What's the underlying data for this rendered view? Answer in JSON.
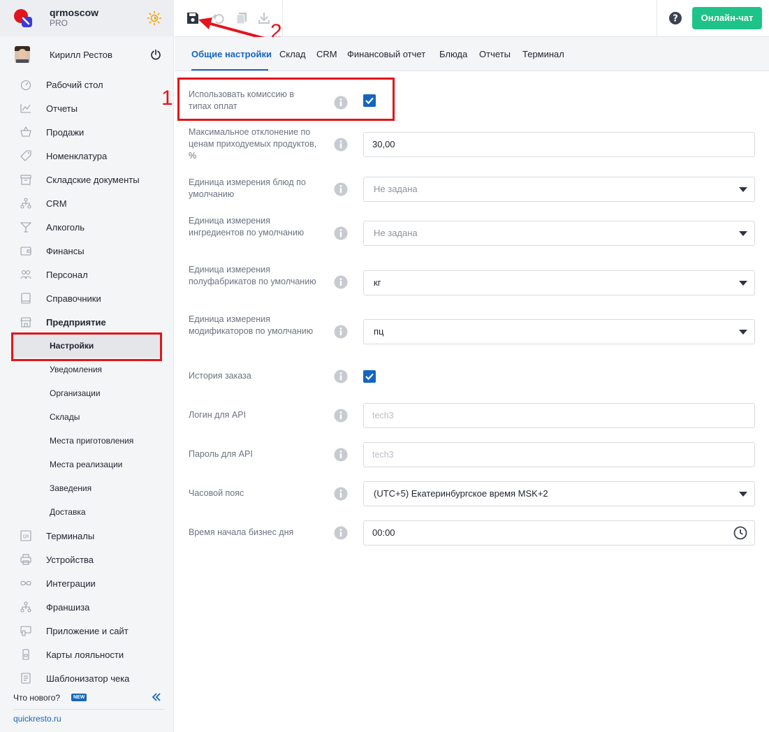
{
  "colors": {
    "accent": "#1565c0",
    "chat": "#1ec38a",
    "annotation": "#e3141b"
  },
  "brand": {
    "name": "qrmoscow",
    "plan": "PRO"
  },
  "user": {
    "name": "Кирилл Рестов"
  },
  "sidebar": {
    "items": [
      {
        "label": "Рабочий стол",
        "icon": "dashboard-icon"
      },
      {
        "label": "Отчеты",
        "icon": "chart-icon"
      },
      {
        "label": "Продажи",
        "icon": "basket-icon"
      },
      {
        "label": "Номенклатура",
        "icon": "tag-icon"
      },
      {
        "label": "Складские документы",
        "icon": "archive-icon"
      },
      {
        "label": "CRM",
        "icon": "hierarchy-icon"
      },
      {
        "label": "Алкоголь",
        "icon": "cocktail-icon"
      },
      {
        "label": "Финансы",
        "icon": "wallet-icon"
      },
      {
        "label": "Персонал",
        "icon": "people-icon"
      },
      {
        "label": "Справочники",
        "icon": "book-icon"
      },
      {
        "label": "Предприятие",
        "icon": "store-icon"
      }
    ],
    "sub_items": [
      {
        "label": "Настройки"
      },
      {
        "label": "Уведомления"
      },
      {
        "label": "Организации"
      },
      {
        "label": "Склады"
      },
      {
        "label": "Места приготовления"
      },
      {
        "label": "Места реализации"
      },
      {
        "label": "Заведения"
      },
      {
        "label": "Доставка"
      }
    ],
    "items_after": [
      {
        "label": "Терминалы",
        "icon": "qr-icon"
      },
      {
        "label": "Устройства",
        "icon": "printer-icon"
      },
      {
        "label": "Интеграции",
        "icon": "infinity-icon"
      },
      {
        "label": "Франшиза",
        "icon": "hierarchy-icon"
      },
      {
        "label": "Приложение и сайт",
        "icon": "devices-icon"
      },
      {
        "label": "Карты лояльности",
        "icon": "card-icon"
      },
      {
        "label": "Шаблонизатор чека",
        "icon": "receipt-icon"
      }
    ],
    "whats_new": "Что нового?",
    "new_badge": "NEW",
    "site_link": "quickresto.ru"
  },
  "toolbar": {
    "chat_label": "Онлайн-чат"
  },
  "annotations": {
    "one": "1",
    "two": "2"
  },
  "tabs": [
    "Общие настройки",
    "Склад",
    "CRM",
    "Финансовый отчет",
    "Блюда",
    "Отчеты",
    "Терминал"
  ],
  "form": {
    "commission": {
      "label": "Использовать комиссию в типах оплат",
      "checked": true
    },
    "max_deviation": {
      "label": "Максимальное отклонение по ценам приходуемых продуктов, %",
      "value": "30,00"
    },
    "dish_unit": {
      "label": "Единица измерения блюд по умолчанию",
      "value": "Не задана"
    },
    "ingredient_unit": {
      "label": "Единица измерения ингредиентов по умолчанию",
      "value": "Не задана"
    },
    "semi_unit": {
      "label": "Единица измерения полуфабрикатов по умолчанию",
      "value": "кг"
    },
    "modifier_unit": {
      "label": "Единица измерения модификаторов по умолчанию",
      "value": "пц"
    },
    "order_history": {
      "label": "История заказа",
      "checked": true
    },
    "api_login": {
      "label": "Логин для API",
      "placeholder": "tech3"
    },
    "api_password": {
      "label": "Пароль для API",
      "placeholder": "tech3"
    },
    "timezone": {
      "label": "Часовой пояс",
      "value": "(UTC+5) Екатеринбургское время MSK+2"
    },
    "day_start": {
      "label": "Время начала бизнес дня",
      "value": "00:00"
    }
  }
}
